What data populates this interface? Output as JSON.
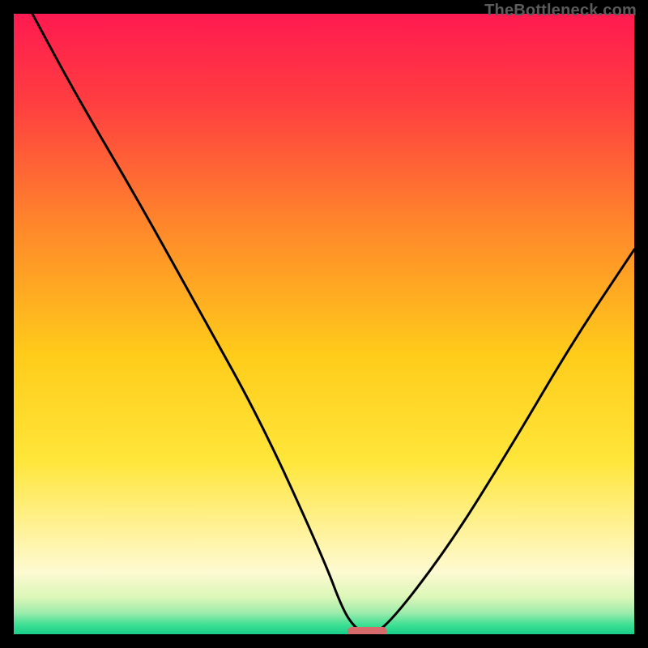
{
  "watermark": {
    "text": "TheBottleneck.com"
  },
  "colors": {
    "frame": "#000000",
    "curve": "#000000",
    "marker": "#d76b6b",
    "gradient_stops": [
      {
        "offset": 0.0,
        "color": "#ff1a50"
      },
      {
        "offset": 0.15,
        "color": "#ff4040"
      },
      {
        "offset": 0.35,
        "color": "#ff8a2a"
      },
      {
        "offset": 0.55,
        "color": "#ffcc1a"
      },
      {
        "offset": 0.72,
        "color": "#ffe63a"
      },
      {
        "offset": 0.84,
        "color": "#fff3a0"
      },
      {
        "offset": 0.9,
        "color": "#fdfad2"
      },
      {
        "offset": 0.94,
        "color": "#dcf7b8"
      },
      {
        "offset": 0.965,
        "color": "#9eecac"
      },
      {
        "offset": 0.985,
        "color": "#3ddf93"
      },
      {
        "offset": 1.0,
        "color": "#18cf8a"
      }
    ]
  },
  "chart_data": {
    "type": "line",
    "title": "",
    "xlabel": "",
    "ylabel": "",
    "xlim": [
      0,
      100
    ],
    "ylim": [
      0,
      100
    ],
    "grid": false,
    "legend": false,
    "series": [
      {
        "name": "bottleneck-curve",
        "x": [
          3,
          10,
          20,
          30,
          40,
          50,
          53,
          55,
          57,
          60,
          70,
          80,
          90,
          100
        ],
        "y": [
          100,
          87,
          70,
          52,
          34,
          12,
          4,
          1,
          0,
          1,
          14,
          30,
          47,
          62
        ]
      }
    ],
    "marker": {
      "x": 57,
      "y": 0.5,
      "width_frac": 0.063,
      "height_frac": 0.014
    }
  }
}
